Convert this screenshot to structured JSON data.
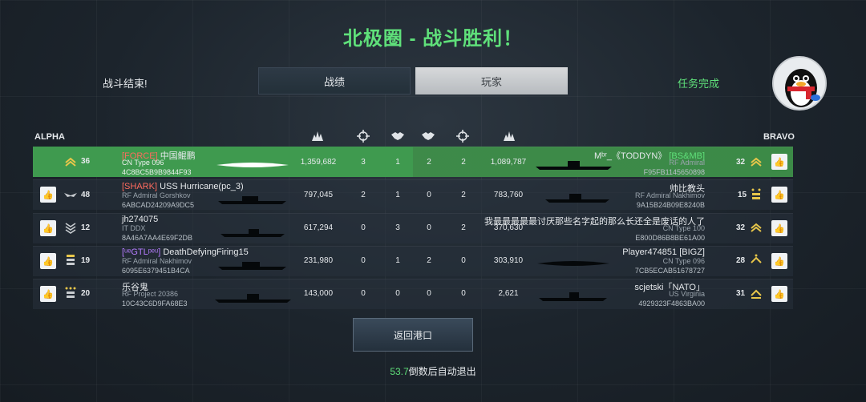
{
  "title": "北极圈 - 战斗胜利！",
  "header": {
    "left_label": "战斗结束!",
    "tabs": [
      {
        "label": "战绩"
      },
      {
        "label": "玩家"
      }
    ],
    "right_label": "任务完成"
  },
  "teams": {
    "left": "ALPHA",
    "right": "BRAVO"
  },
  "alpha": [
    {
      "level": "36",
      "clan": "[FORCE]",
      "name": "中国鲲鹏",
      "ship": "CN Type 096",
      "code": "4C8BC5B9B9844F93",
      "damage": "1,359,682",
      "kills": "3",
      "assists": "1"
    },
    {
      "level": "48",
      "clan": "[SHARK]",
      "name": "USS Hurricane(pc_3)",
      "ship": "RF Admiral Gorshkov",
      "code": "6ABCAD24209A9DC5",
      "damage": "797,045",
      "kills": "2",
      "assists": "1"
    },
    {
      "level": "12",
      "clan": "",
      "name": "jh274075",
      "ship": "IT DDX",
      "code": "8A46A7AA4E69F2DB",
      "damage": "617,294",
      "kills": "0",
      "assists": "3"
    },
    {
      "level": "19",
      "clan": "[ᵘᵉGTLᵖᵉᵘ]",
      "name": "DeathDefyingFiring15",
      "ship": "RF Admiral Nakhimov",
      "code": "6095E6379451B4CA",
      "damage": "231,980",
      "kills": "0",
      "assists": "1"
    },
    {
      "level": "20",
      "clan": "",
      "name": "乐谷鬼",
      "ship": "RF Project 20386",
      "code": "10C43C6D9FA68E3",
      "damage": "143,000",
      "kills": "0",
      "assists": "0"
    }
  ],
  "bravo": [
    {
      "level": "32",
      "clan": "[BS&MB]",
      "name": "Mᵇʳ_《TODDYN》",
      "ship": "RF Admiral",
      "code": "F95FB1145650898",
      "damage": "1,089,787",
      "kills": "2",
      "assists": "2"
    },
    {
      "level": "15",
      "clan": "",
      "name": "帅比教头",
      "ship": "RF Admiral Nakhimov",
      "code": "9A15B24B09E8240B",
      "damage": "783,760",
      "kills": "2",
      "assists": "0"
    },
    {
      "level": "32",
      "clan": "",
      "name": "我最最最最最讨厌那些名字起的那么长还全是废话的人了",
      "ship": "CN Type 100",
      "code": "E800D86B8BE61A00",
      "damage": "370,630",
      "kills": "2",
      "assists": "0"
    },
    {
      "level": "28",
      "clan": "",
      "name": "Player474851 [BIGZ]",
      "ship": "CN Type 096",
      "code": "7CB5ECAB51678727",
      "damage": "303,910",
      "kills": "0",
      "assists": "2"
    },
    {
      "level": "31",
      "clan": "",
      "name": "scjetski「NATO」",
      "ship": "US Virginia",
      "code": "4929323F4863BA00",
      "damage": "2,621",
      "kills": "0",
      "assists": "0"
    }
  ],
  "buttons": {
    "return": "返回港口"
  },
  "countdown": {
    "number": "53.7",
    "text": "倒数后自动退出"
  },
  "icons": [
    "explosion-icon",
    "crosshair-icon",
    "handshake-icon",
    "crosshair-icon",
    "explosion-icon",
    "thumbs-up-icon"
  ],
  "colors": {
    "accent_green": "#5fe07a",
    "clan_red": "#ff6b5e",
    "clan_purple": "#b67cff"
  }
}
